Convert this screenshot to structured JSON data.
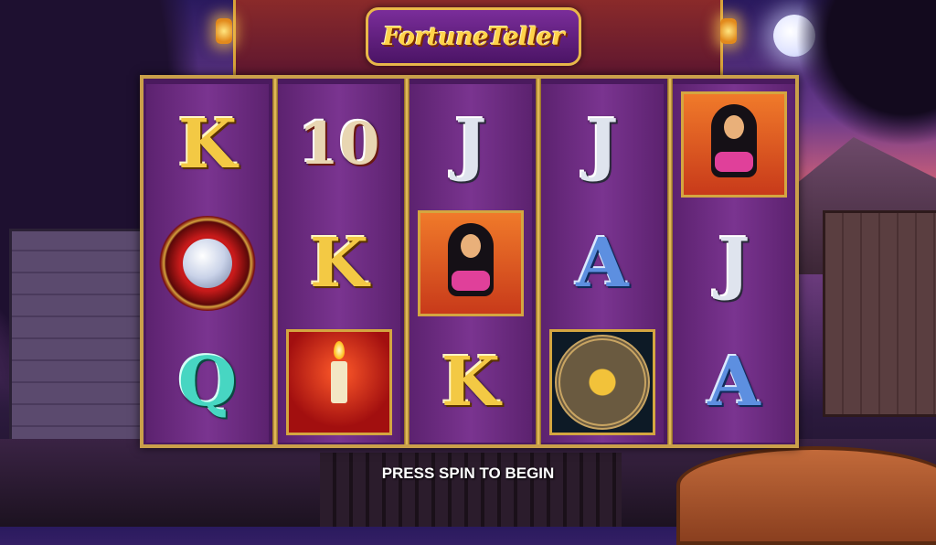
{
  "game": {
    "logo_text": "FortuneTeller",
    "status_message": "PRESS SPIN TO BEGIN"
  },
  "colors": {
    "frame_gold": "#caa04a",
    "reel_purple": "#7a3490",
    "logo_purple": "#7a2d9a",
    "logo_text": "#ffd34a"
  },
  "reels": [
    {
      "symbols": [
        {
          "name": "K",
          "label": "K",
          "style": "gold"
        },
        {
          "name": "crystal-ball",
          "label": "",
          "style": "picture"
        },
        {
          "name": "Q",
          "label": "Q",
          "style": "teal"
        }
      ]
    },
    {
      "symbols": [
        {
          "name": "10",
          "label": "10",
          "style": "ten"
        },
        {
          "name": "K",
          "label": "K",
          "style": "gold"
        },
        {
          "name": "candle",
          "label": "",
          "style": "picture"
        }
      ]
    },
    {
      "symbols": [
        {
          "name": "J",
          "label": "J",
          "style": "silver"
        },
        {
          "name": "fortune-teller",
          "label": "",
          "style": "picture"
        },
        {
          "name": "K",
          "label": "K",
          "style": "gold"
        }
      ]
    },
    {
      "symbols": [
        {
          "name": "J",
          "label": "J",
          "style": "silver"
        },
        {
          "name": "A",
          "label": "A",
          "style": "blue"
        },
        {
          "name": "zodiac-wheel",
          "label": "",
          "style": "picture"
        }
      ]
    },
    {
      "symbols": [
        {
          "name": "fortune-teller",
          "label": "",
          "style": "picture"
        },
        {
          "name": "J",
          "label": "J",
          "style": "silver"
        },
        {
          "name": "A",
          "label": "A",
          "style": "blue"
        }
      ]
    }
  ]
}
